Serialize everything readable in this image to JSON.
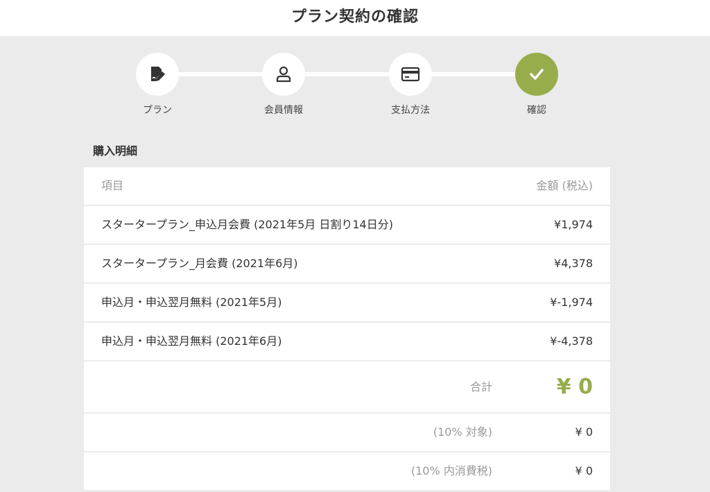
{
  "header": {
    "title": "プラン契約の確認"
  },
  "steps": [
    {
      "label": "プラン",
      "icon": "plan-edit-icon"
    },
    {
      "label": "会員情報",
      "icon": "user-icon"
    },
    {
      "label": "支払方法",
      "icon": "credit-card-icon"
    },
    {
      "label": "確認",
      "icon": "check-icon",
      "active": true
    }
  ],
  "colors": {
    "accent": "#97ad4c",
    "background": "#ebebeb"
  },
  "purchase": {
    "title": "購入明細",
    "header": {
      "item": "項目",
      "amount": "金額 (税込)"
    },
    "rows": [
      {
        "item": "スタータープラン_申込月会費 (2021年5月 日割り14日分)",
        "amount": "¥1,974"
      },
      {
        "item": "スタータープラン_月会費 (2021年6月)",
        "amount": "¥4,378"
      },
      {
        "item": "申込月・申込翌月無料 (2021年5月)",
        "amount": "¥-1,974"
      },
      {
        "item": "申込月・申込翌月無料 (2021年6月)",
        "amount": "¥-4,378"
      }
    ],
    "total": {
      "label": "合計",
      "amount": "¥ 0"
    },
    "tax_target": {
      "label": "(10% 対象)",
      "amount": "¥ 0"
    },
    "tax_included": {
      "label": "(10% 内消費税)",
      "amount": "¥ 0"
    }
  }
}
